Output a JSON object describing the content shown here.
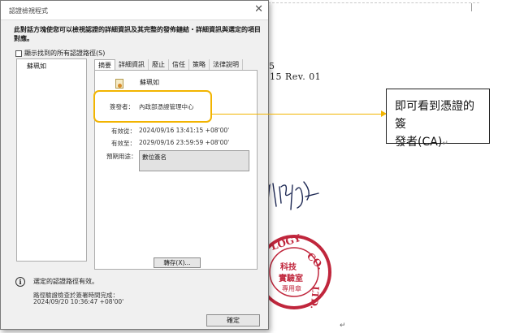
{
  "document": {
    "digit_fragment": "5",
    "rev_line": "15    Rev.  01",
    "paragraph_mark": "↵"
  },
  "dialog": {
    "title": "認證檢視程式",
    "close_icon": "close-icon",
    "description": "此對話方塊使您可以檢視認證的詳細資訊及其完整的發佈鏈結・詳細資訊與選定的項目對應。",
    "show_all_label": "顯示找到的所有認證路徑(S)",
    "tree_item": "蘇珮如",
    "tabs": [
      "摘要",
      "詳細資訊",
      "廢止",
      "信任",
      "策略",
      "法律說明"
    ],
    "cert_name": "蘇珮如",
    "issuer_label": "簽發者：",
    "issuer_value": "內政部憑證管理中心",
    "valid_from_label": "有效從：",
    "valid_from_value": "2024/09/16 13:41:15 +08'00'",
    "valid_to_label": "有效至：",
    "valid_to_value": "2029/09/16 23:59:59 +08'00'",
    "purpose_label": "預期用途：",
    "purpose_value": "數位簽名",
    "export_button": "轉存(X)...",
    "status_text": "選定的認證路徑有效。",
    "verify_line1": "路徑驗證檢查於簽署時間完成：",
    "verify_line2": "2024/09/20 10:36:47 +08'00'",
    "ok_button": "確定"
  },
  "callout": {
    "line1": "即可看到憑證的簽",
    "line2": "發者(CA)"
  },
  "colors": {
    "highlight": "#f2b400",
    "stamp_red": "#c0263c"
  }
}
